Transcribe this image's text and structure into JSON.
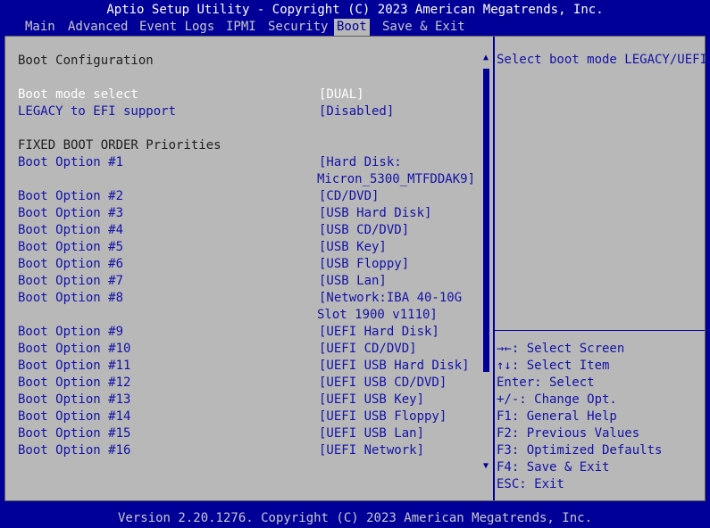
{
  "title": "Aptio Setup Utility - Copyright (C) 2023 American Megatrends, Inc.",
  "tabs": [
    "Main",
    "Advanced",
    "Event Logs",
    "IPMI",
    "Security",
    "Boot",
    "Save & Exit"
  ],
  "active_tab": "Boot",
  "section_title": "Boot Configuration",
  "boot_mode": {
    "label": "Boot mode select",
    "value": "[DUAL]"
  },
  "legacy_efi": {
    "label": "LEGACY to EFI support",
    "value": "[Disabled]"
  },
  "fixed_order_title": "FIXED BOOT ORDER Priorities",
  "boot_options": [
    {
      "label": "Boot Option #1",
      "value": "[Hard Disk:",
      "value2": "Micron_5300_MTFDDAK9]"
    },
    {
      "label": "Boot Option #2",
      "value": "[CD/DVD]"
    },
    {
      "label": "Boot Option #3",
      "value": "[USB Hard Disk]"
    },
    {
      "label": "Boot Option #4",
      "value": "[USB CD/DVD]"
    },
    {
      "label": "Boot Option #5",
      "value": "[USB Key]"
    },
    {
      "label": "Boot Option #6",
      "value": "[USB Floppy]"
    },
    {
      "label": "Boot Option #7",
      "value": "[USB Lan]"
    },
    {
      "label": "Boot Option #8",
      "value": "[Network:IBA 40-10G",
      "value2": "Slot 1900 v1110]"
    },
    {
      "label": "Boot Option #9",
      "value": "[UEFI Hard Disk]"
    },
    {
      "label": "Boot Option #10",
      "value": "[UEFI CD/DVD]"
    },
    {
      "label": "Boot Option #11",
      "value": "[UEFI USB Hard Disk]"
    },
    {
      "label": "Boot Option #12",
      "value": "[UEFI USB CD/DVD]"
    },
    {
      "label": "Boot Option #13",
      "value": "[UEFI USB Key]"
    },
    {
      "label": "Boot Option #14",
      "value": "[UEFI USB Floppy]"
    },
    {
      "label": "Boot Option #15",
      "value": "[UEFI USB Lan]"
    },
    {
      "label": "Boot Option #16",
      "value": "[UEFI Network]"
    }
  ],
  "help_text": "Select boot mode LEGACY/UEFI",
  "keys": [
    "→←: Select Screen",
    "↑↓: Select Item",
    "Enter: Select",
    "+/-: Change Opt.",
    "F1: General Help",
    "F2: Previous Values",
    "F3: Optimized Defaults",
    "F4: Save & Exit",
    "ESC: Exit"
  ],
  "scroll": {
    "up_icon": "triangle-up",
    "down_icon": "triangle-down",
    "position_fraction": 0.0
  },
  "colors": {
    "background": "#000098",
    "panel": "#b8b8b8",
    "highlight_text": "#1212a8"
  },
  "footer": "Version 2.20.1276. Copyright (C) 2023 American Megatrends, Inc."
}
